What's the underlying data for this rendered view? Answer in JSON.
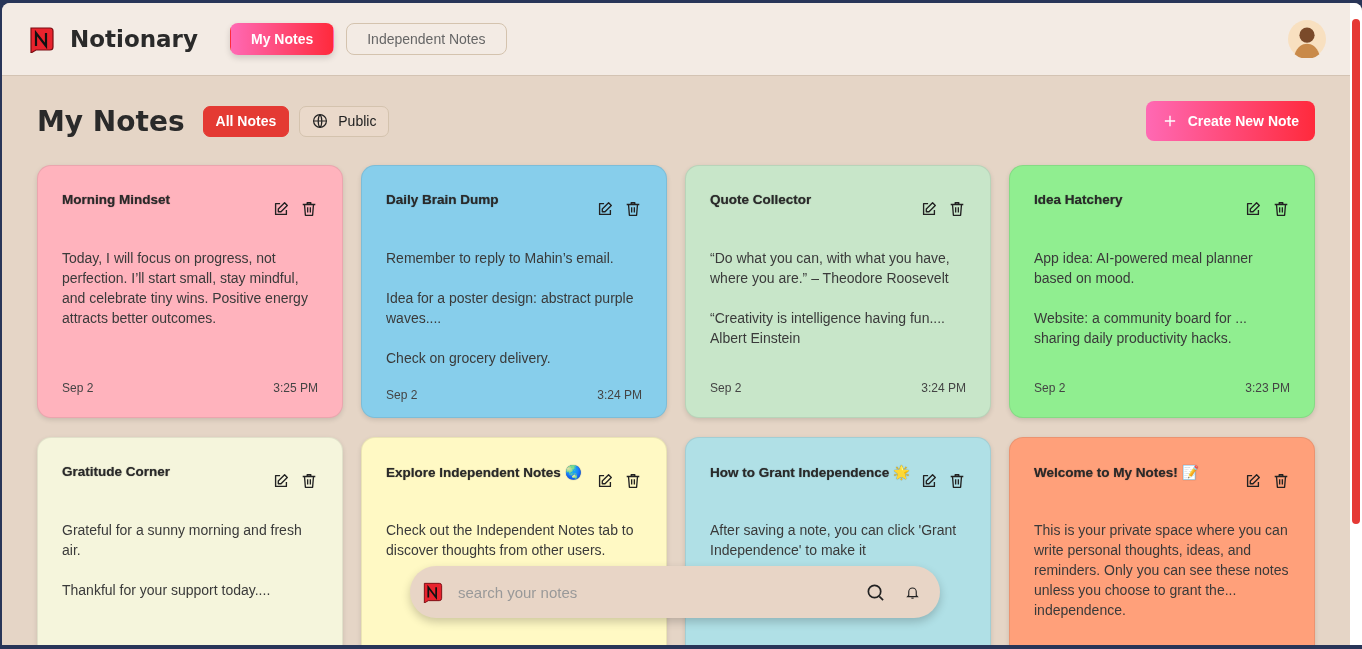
{
  "app": {
    "name": "Notionary"
  },
  "nav_tabs": [
    {
      "label": "My Notes",
      "selected": true
    },
    {
      "label": "Independent Notes",
      "selected": false
    }
  ],
  "page": {
    "title": "My Notes"
  },
  "filters": [
    {
      "label": "All Notes",
      "selected": true,
      "kind": "plain"
    },
    {
      "label": "Public",
      "selected": false,
      "kind": "globe"
    }
  ],
  "create_button": {
    "label": "Create New Note"
  },
  "notes": [
    {
      "title": "Morning Mindset",
      "color": "#ffb3bd",
      "body": [
        "Today, I will focus on progress, not perfection. I’ll start small, stay mindful, and celebrate tiny wins. Positive energy attracts better outcomes."
      ],
      "date": "Sep 2",
      "time": "3:25 PM"
    },
    {
      "title": "Daily Brain Dump",
      "color": "#87ceeb",
      "body": [
        "Remember to reply to Mahin’s email.",
        "Idea for a poster design: abstract purple waves....",
        "Check on grocery delivery."
      ],
      "date": "Sep 2",
      "time": "3:24 PM"
    },
    {
      "title": "Quote Collector",
      "color": "#c8e6c9",
      "body": [
        "“Do what you can, with what you have, where you are.” – Theodore Roosevelt",
        "“Creativity is intelligence having fun.... Albert Einstein"
      ],
      "date": "Sep 2",
      "time": "3:24 PM"
    },
    {
      "title": "Idea Hatchery",
      "color": "#90ee90",
      "body": [
        "App idea: AI-powered meal planner based on mood.",
        "Website: a community board for ... sharing daily productivity hacks."
      ],
      "date": "Sep 2",
      "time": "3:23 PM"
    },
    {
      "title": "Gratitude Corner",
      "color": "#f5f5dc",
      "body": [
        "Grateful for a sunny morning and fresh air.",
        "Thankful for your support today...."
      ]
    },
    {
      "title": "Explore Independent Notes 🌏",
      "color": "#fff9c4",
      "body": [
        "Check out the Independent Notes tab to discover thoughts from other users."
      ]
    },
    {
      "title": "How to Grant Independence 🌟",
      "color": "#b0e0e6",
      "body": [
        "After saving a note, you can click 'Grant Independence' to make it"
      ]
    },
    {
      "title": "Welcome to My Notes! 📝",
      "color": "#ffa07a",
      "body": [
        "This is your private space where you can write personal thoughts, ideas, and reminders. Only you can see these notes unless you choose to grant the... independence."
      ]
    }
  ],
  "search": {
    "placeholder": "search your notes"
  }
}
